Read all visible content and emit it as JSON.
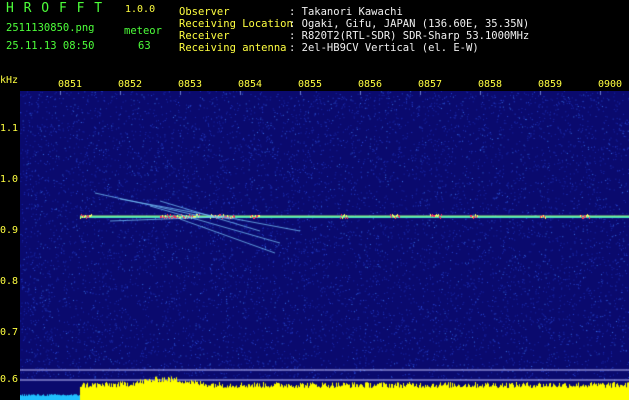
{
  "header": {
    "logo": "H R O F F T",
    "version": "1.0.0",
    "filename": "2511130850.png",
    "datetime": "25.11.13 08:50",
    "detector_label": "meteor",
    "detector_count": "63",
    "info_labels": [
      "Observer",
      "Receiving Location",
      "Receiver",
      "Receiving antenna"
    ],
    "info_values": [
      ": Takanori Kawachi",
      ": Ogaki, Gifu, JAPAN (136.60E, 35.35N)",
      ": R820T2(RTL-SDR) SDR-Sharp 53.1000MHz",
      ": 2el-HB9CV Vertical (el. E-W)"
    ]
  },
  "axis": {
    "unit": "kHz",
    "y_ticks": [
      "1.1",
      "1.0",
      "0.9",
      "0.8",
      "0.7",
      "0.6"
    ],
    "x_ticks": [
      "0851",
      "0852",
      "0853",
      "0854",
      "0855",
      "0856",
      "0857",
      "0858",
      "0859",
      "0900"
    ]
  },
  "colors": {
    "background": "#000000",
    "header_text": "#4dff3a",
    "values_text": "#ffff40",
    "spectrogram_bg": "#0a0a6e",
    "carrier": "#40e0c0",
    "activity_bar": "#ffff00"
  }
}
